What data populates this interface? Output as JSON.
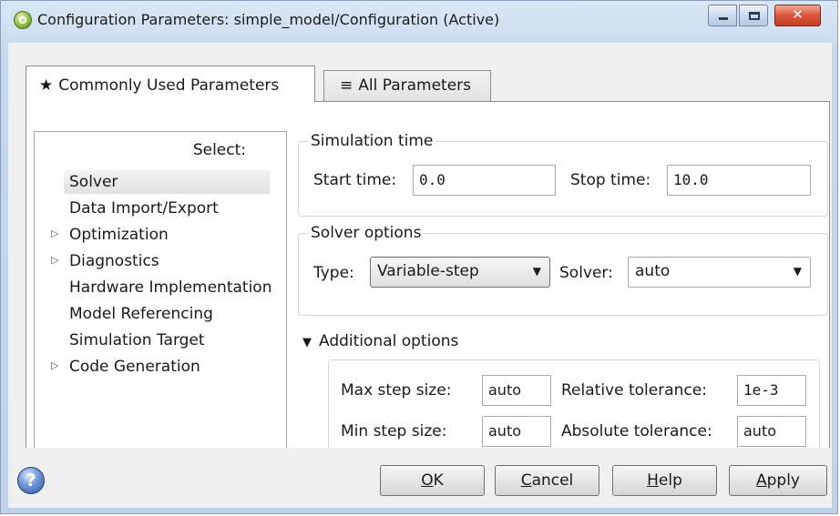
{
  "window": {
    "title": "Configuration Parameters: simple_model/Configuration (Active)",
    "controls": {
      "minimize": "minimize-icon",
      "maximize": "maximize-icon",
      "close": "✕"
    }
  },
  "tabs": [
    {
      "label": "Commonly Used Parameters",
      "icon": "★",
      "selected": true
    },
    {
      "label": "All Parameters",
      "icon": "≡",
      "selected": false
    }
  ],
  "tree": {
    "header": "Select:",
    "items": [
      {
        "label": "Solver",
        "expandable": false,
        "selected": true
      },
      {
        "label": "Data Import/Export",
        "expandable": false
      },
      {
        "label": "Optimization",
        "expandable": true,
        "expander": "▷"
      },
      {
        "label": "Diagnostics",
        "expandable": true,
        "expander": "▷"
      },
      {
        "label": "Hardware Implementation",
        "expandable": false
      },
      {
        "label": "Model Referencing",
        "expandable": false
      },
      {
        "label": "Simulation Target",
        "expandable": false
      },
      {
        "label": "Code Generation",
        "expandable": true,
        "expander": "▷"
      }
    ]
  },
  "simulation_time": {
    "title": "Simulation time",
    "start_label": "Start time:",
    "start_value": "0.0",
    "stop_label": "Stop time:",
    "stop_value": "10.0"
  },
  "solver_options": {
    "title": "Solver options",
    "type_label": "Type:",
    "type_value": "Variable-step",
    "solver_label": "Solver:",
    "solver_value": "auto",
    "dropdown_arrow": "▼"
  },
  "additional_options": {
    "label": "Additional options",
    "toggle": "▼",
    "max_step_label": "Max step size:",
    "max_step_value": "auto",
    "relative_tol_label": "Relative tolerance:",
    "relative_tol_value": "1e-3",
    "min_step_label": "Min step size:",
    "min_step_value": "auto",
    "absolute_tol_label": "Absolute tolerance:",
    "absolute_tol_value": "auto"
  },
  "footer": {
    "help_icon": "?",
    "ok": {
      "mnemonic": "O",
      "rest": "K"
    },
    "cancel": {
      "mnemonic": "C",
      "rest": "ancel"
    },
    "help": {
      "mnemonic": "H",
      "rest": "elp"
    },
    "apply": {
      "mnemonic": "A",
      "rest": "pply"
    }
  }
}
